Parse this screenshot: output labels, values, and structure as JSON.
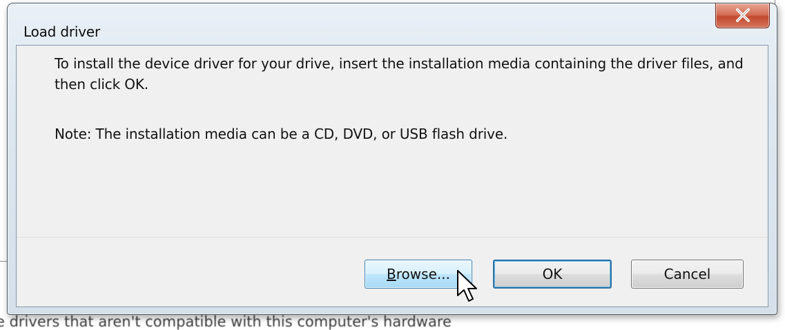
{
  "background": {
    "partial_text": "e drivers that aren't compatible with this computer's hardware"
  },
  "dialog": {
    "title": "Load driver",
    "close_symbol": "X",
    "message_line": "To install the device driver for your drive, insert the installation media containing the driver files, and then click OK.",
    "note": "Note: The installation media can be a CD, DVD, or USB flash drive.",
    "buttons": {
      "browse_accel": "B",
      "browse_rest": "rowse...",
      "ok": "OK",
      "cancel": "Cancel"
    },
    "colors": {
      "close_button": "#c24a30",
      "focus_border": "#2e6fa2",
      "hover_button": "#bee6fd"
    },
    "icons": [
      "close-icon",
      "arrow-cursor-icon"
    ]
  }
}
